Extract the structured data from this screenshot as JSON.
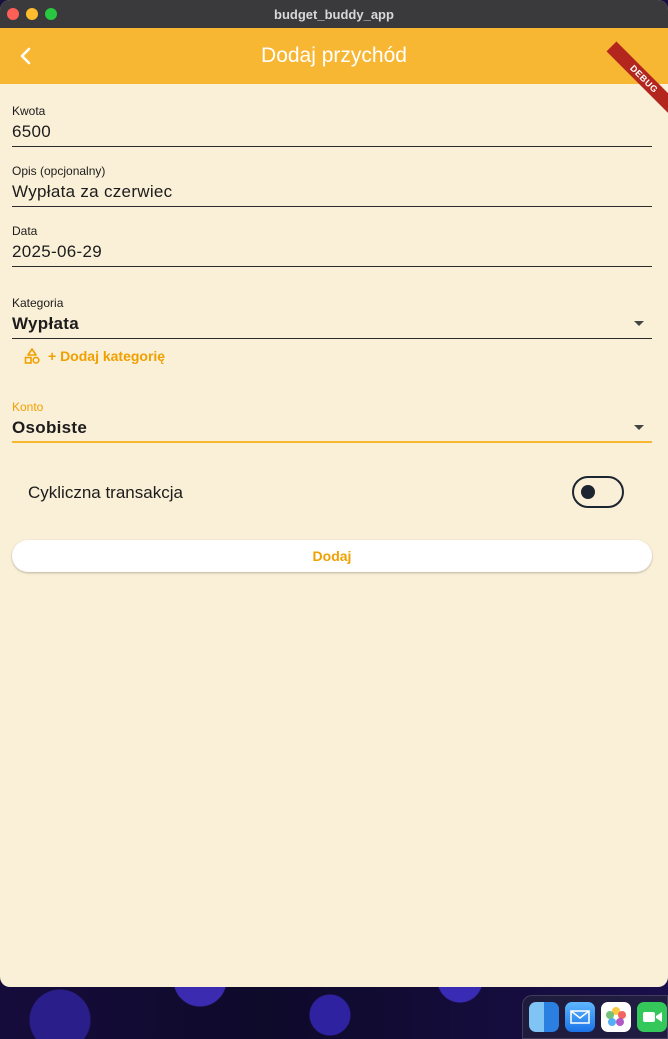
{
  "window": {
    "title": "budget_buddy_app"
  },
  "appbar": {
    "title": "Dodaj przychód",
    "debug_label": "DEBUG"
  },
  "form": {
    "amount": {
      "label": "Kwota",
      "value": "6500"
    },
    "description": {
      "label": "Opis (opcjonalny)",
      "value": "Wypłata za czerwiec"
    },
    "date": {
      "label": "Data",
      "value": "2025-06-29"
    },
    "category": {
      "label": "Kategoria",
      "value": "Wypłata"
    },
    "add_category_label": "+ Dodaj kategorię",
    "account": {
      "label": "Konto",
      "value": "Osobiste"
    },
    "recurring": {
      "label": "Cykliczna transakcja",
      "on": false
    },
    "submit_label": "Dodaj"
  },
  "colors": {
    "accent": "#f8b733",
    "accent_text": "#f0a000",
    "background": "#faefd7"
  },
  "dock": {
    "icons": [
      "finder-icon",
      "mail-icon",
      "photos-icon",
      "facetime-icon"
    ]
  }
}
